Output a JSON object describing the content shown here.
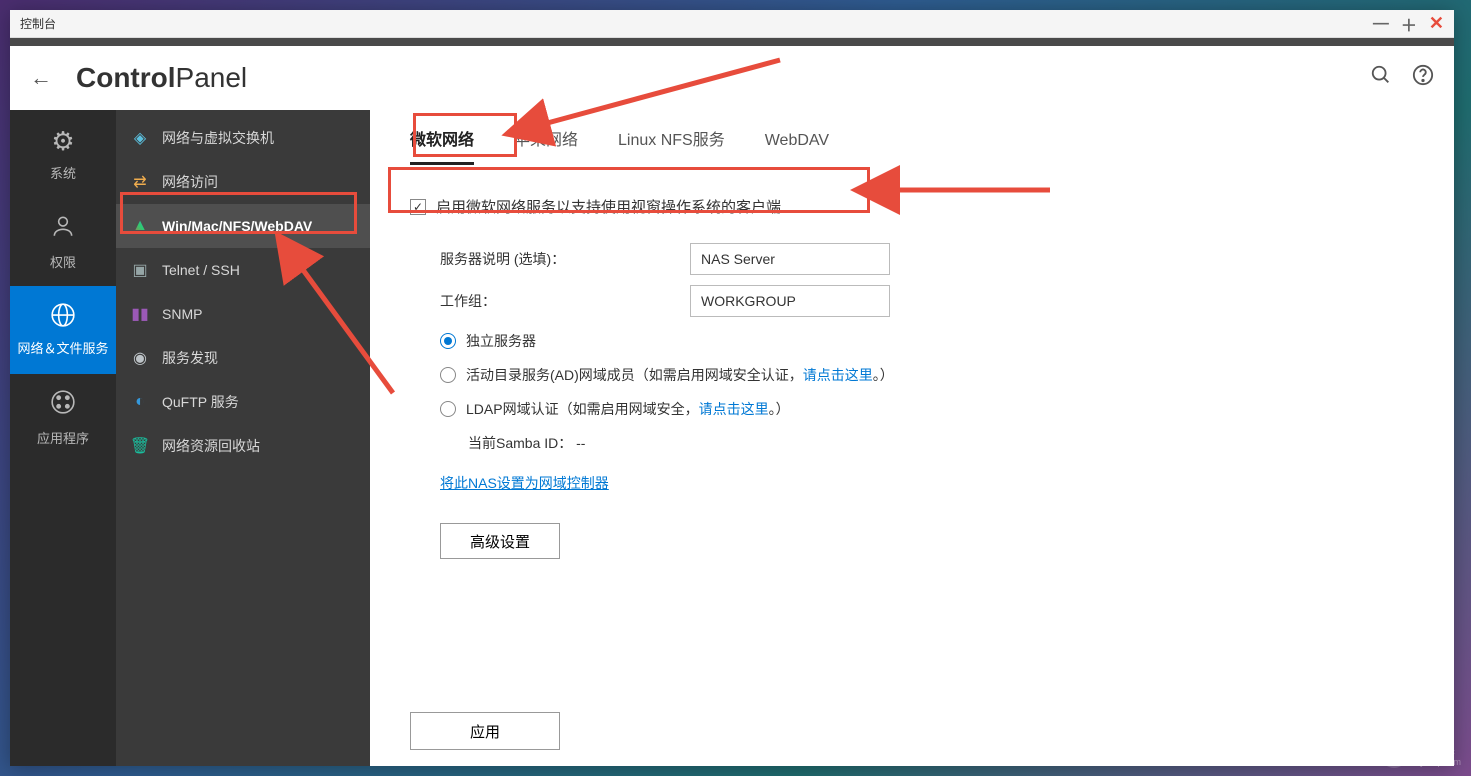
{
  "window": {
    "title": "控制台"
  },
  "header": {
    "title_bold": "Control",
    "title_light": "Panel"
  },
  "primary_nav": [
    {
      "icon": "⚙",
      "label": "系统"
    },
    {
      "icon": "👤",
      "label": "权限"
    },
    {
      "icon": "🌐",
      "label": "网络＆文件服务"
    },
    {
      "icon": "⊞",
      "label": "应用程序"
    }
  ],
  "secondary_nav": [
    {
      "icon": "◈",
      "label": "网络与虚拟交换机",
      "cls": "ci-network"
    },
    {
      "icon": "⇄",
      "label": "网络访问",
      "cls": "ci-access"
    },
    {
      "icon": "▲",
      "label": "Win/Mac/NFS/WebDAV",
      "cls": "ci-win"
    },
    {
      "icon": "▣",
      "label": "Telnet / SSH",
      "cls": "ci-ssh"
    },
    {
      "icon": "▮▮",
      "label": "SNMP",
      "cls": "ci-snmp"
    },
    {
      "icon": "◉",
      "label": "服务发现",
      "cls": "ci-discover"
    },
    {
      "icon": "◐",
      "label": "QuFTP 服务",
      "cls": "ci-quftp"
    },
    {
      "icon": "🗑",
      "label": "网络资源回收站",
      "cls": "ci-recycle"
    }
  ],
  "tabs": [
    {
      "label": "微软网络"
    },
    {
      "label": "苹果网络"
    },
    {
      "label": "Linux NFS服务"
    },
    {
      "label": "WebDAV"
    }
  ],
  "content": {
    "enable_checkbox_label": "启用微软网络服务以支持使用视窗操作系统的客户端",
    "server_desc_label": "服务器说明 (选填)：",
    "server_desc_value": "NAS Server",
    "workgroup_label": "工作组：",
    "workgroup_value": "WORKGROUP",
    "radio1": "独立服务器",
    "radio2_prefix": "活动目录服务(AD)网域成员（如需启用网域安全认证，",
    "radio2_link": "请点击这里",
    "radio2_suffix": "。）",
    "radio3_prefix": "LDAP网域认证（如需启用网域安全，",
    "radio3_link": "请点击这里",
    "radio3_suffix": "。）",
    "samba_id_label": "当前Samba ID： --",
    "nas_link": "将此NAS设置为网域控制器",
    "advanced_button": "高级设置",
    "apply_button": "应用"
  },
  "watermark": {
    "text": "路由器",
    "sub": "luyouqi.com"
  }
}
